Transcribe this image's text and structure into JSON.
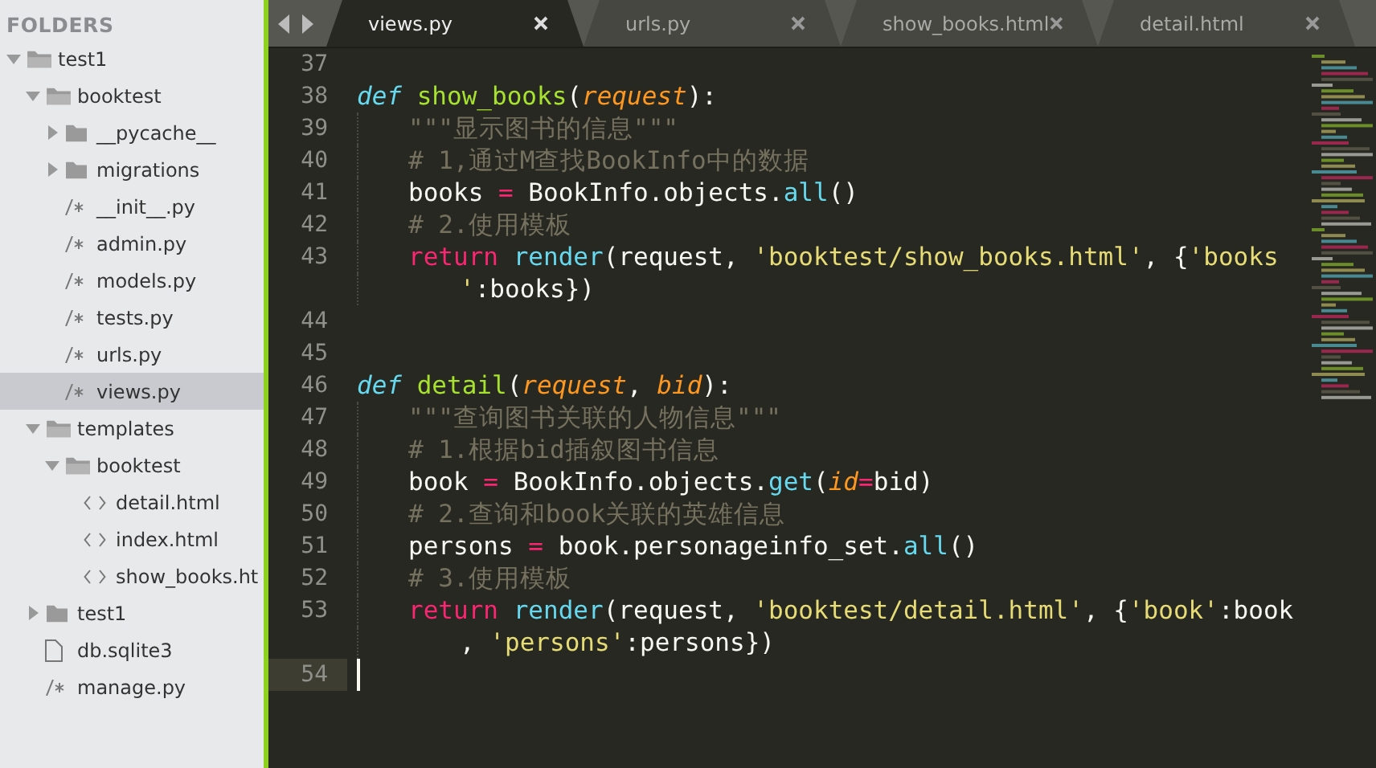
{
  "sidebar": {
    "title": "FOLDERS",
    "tree": [
      {
        "name": "test1",
        "kind": "folder",
        "expanded": true,
        "selected": false,
        "children": [
          {
            "name": "booktest",
            "kind": "folder",
            "expanded": true,
            "selected": false,
            "children": [
              {
                "name": "__pycache__",
                "kind": "folder",
                "expanded": false,
                "selected": false
              },
              {
                "name": "migrations",
                "kind": "folder",
                "expanded": false,
                "selected": false
              },
              {
                "name": "__init__.py",
                "kind": "script",
                "selected": false
              },
              {
                "name": "admin.py",
                "kind": "script",
                "selected": false
              },
              {
                "name": "models.py",
                "kind": "script",
                "selected": false
              },
              {
                "name": "tests.py",
                "kind": "script",
                "selected": false
              },
              {
                "name": "urls.py",
                "kind": "script",
                "selected": false
              },
              {
                "name": "views.py",
                "kind": "script",
                "selected": true
              }
            ]
          },
          {
            "name": "templates",
            "kind": "folder",
            "expanded": true,
            "selected": false,
            "children": [
              {
                "name": "booktest",
                "kind": "folder",
                "expanded": true,
                "selected": false,
                "children": [
                  {
                    "name": "detail.html",
                    "kind": "markup",
                    "selected": false
                  },
                  {
                    "name": "index.html",
                    "kind": "markup",
                    "selected": false
                  },
                  {
                    "name": "show_books.ht",
                    "kind": "markup",
                    "selected": false
                  }
                ]
              }
            ]
          },
          {
            "name": "test1",
            "kind": "folder",
            "expanded": false,
            "selected": false
          },
          {
            "name": "db.sqlite3",
            "kind": "document",
            "selected": false
          },
          {
            "name": "manage.py",
            "kind": "script",
            "selected": false
          }
        ]
      }
    ]
  },
  "tabs": [
    {
      "label": "views.py",
      "selected": true
    },
    {
      "label": "urls.py",
      "selected": false
    },
    {
      "label": "show_books.html",
      "selected": false
    },
    {
      "label": "detail.html",
      "selected": false
    }
  ],
  "editor": {
    "lines": [
      {
        "number": "37",
        "indented": false,
        "current": false
      },
      {
        "number": "38",
        "indented": false,
        "current": false,
        "tokens": [
          {
            "kind": "storage",
            "text": "def "
          },
          {
            "kind": "name",
            "text": "show_books"
          },
          {
            "kind": "plain",
            "text": "("
          },
          {
            "kind": "param",
            "text": "request"
          },
          {
            "kind": "plain",
            "text": "):"
          }
        ]
      },
      {
        "number": "39",
        "indented": true,
        "current": false,
        "tokens": [
          {
            "kind": "comment",
            "text": "\"\"\"显示图书的信息\"\"\""
          }
        ]
      },
      {
        "number": "40",
        "indented": true,
        "current": false,
        "tokens": [
          {
            "kind": "comment",
            "text": "# 1,通过M查找BookInfo中的数据"
          }
        ]
      },
      {
        "number": "41",
        "indented": true,
        "current": false,
        "tokens": [
          {
            "kind": "plain",
            "text": "books "
          },
          {
            "kind": "operator",
            "text": "="
          },
          {
            "kind": "plain",
            "text": " BookInfo.objects."
          },
          {
            "kind": "builtin",
            "text": "all"
          },
          {
            "kind": "plain",
            "text": "()"
          }
        ]
      },
      {
        "number": "42",
        "indented": true,
        "current": false,
        "tokens": [
          {
            "kind": "comment",
            "text": "# 2.使用模板"
          }
        ]
      },
      {
        "number": "43",
        "indented": true,
        "current": false,
        "tokens": [
          {
            "kind": "keyword",
            "text": "return "
          },
          {
            "kind": "builtin",
            "text": "render"
          },
          {
            "kind": "plain",
            "text": "(request, "
          },
          {
            "kind": "string",
            "text": "'booktest/show_books.html'"
          },
          {
            "kind": "plain",
            "text": ", {"
          },
          {
            "kind": "string",
            "text": "'books"
          }
        ],
        "wrapped": [
          {
            "kind": "string",
            "text": "'"
          },
          {
            "kind": "plain",
            "text": ":books})"
          }
        ]
      },
      {
        "number": "44",
        "indented": false,
        "current": false
      },
      {
        "number": "45",
        "indented": false,
        "current": false
      },
      {
        "number": "46",
        "indented": false,
        "current": false,
        "tokens": [
          {
            "kind": "storage",
            "text": "def "
          },
          {
            "kind": "name",
            "text": "detail"
          },
          {
            "kind": "plain",
            "text": "("
          },
          {
            "kind": "param",
            "text": "request"
          },
          {
            "kind": "plain",
            "text": ", "
          },
          {
            "kind": "param",
            "text": "bid"
          },
          {
            "kind": "plain",
            "text": "):"
          }
        ]
      },
      {
        "number": "47",
        "indented": true,
        "current": false,
        "tokens": [
          {
            "kind": "comment",
            "text": "\"\"\"查询图书关联的人物信息\"\"\""
          }
        ]
      },
      {
        "number": "48",
        "indented": true,
        "current": false,
        "tokens": [
          {
            "kind": "comment",
            "text": "# 1.根据bid插叙图书信息"
          }
        ]
      },
      {
        "number": "49",
        "indented": true,
        "current": false,
        "tokens": [
          {
            "kind": "plain",
            "text": "book "
          },
          {
            "kind": "operator",
            "text": "="
          },
          {
            "kind": "plain",
            "text": " BookInfo.objects."
          },
          {
            "kind": "builtin",
            "text": "get"
          },
          {
            "kind": "plain",
            "text": "("
          },
          {
            "kind": "param",
            "text": "id"
          },
          {
            "kind": "operator",
            "text": "="
          },
          {
            "kind": "plain",
            "text": "bid)"
          }
        ]
      },
      {
        "number": "50",
        "indented": true,
        "current": false,
        "tokens": [
          {
            "kind": "comment",
            "text": "# 2.查询和book关联的英雄信息"
          }
        ]
      },
      {
        "number": "51",
        "indented": true,
        "current": false,
        "tokens": [
          {
            "kind": "plain",
            "text": "persons "
          },
          {
            "kind": "operator",
            "text": "="
          },
          {
            "kind": "plain",
            "text": " book.personageinfo_set."
          },
          {
            "kind": "builtin",
            "text": "all"
          },
          {
            "kind": "plain",
            "text": "()"
          }
        ]
      },
      {
        "number": "52",
        "indented": true,
        "current": false,
        "tokens": [
          {
            "kind": "comment",
            "text": "# 3.使用模板"
          }
        ]
      },
      {
        "number": "53",
        "indented": true,
        "current": false,
        "tokens": [
          {
            "kind": "keyword",
            "text": "return "
          },
          {
            "kind": "builtin",
            "text": "render"
          },
          {
            "kind": "plain",
            "text": "(request, "
          },
          {
            "kind": "string",
            "text": "'booktest/detail.html'"
          },
          {
            "kind": "plain",
            "text": ", {"
          },
          {
            "kind": "string",
            "text": "'book'"
          },
          {
            "kind": "plain",
            "text": ":book"
          }
        ],
        "wrapped": [
          {
            "kind": "plain",
            "text": ", "
          },
          {
            "kind": "string",
            "text": "'persons'"
          },
          {
            "kind": "plain",
            "text": ":persons})"
          }
        ]
      },
      {
        "number": "54",
        "indented": false,
        "current": true
      }
    ]
  }
}
